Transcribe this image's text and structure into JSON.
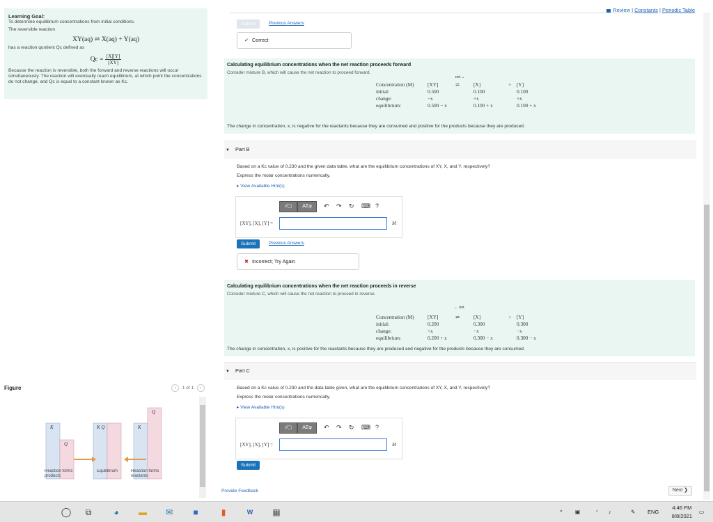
{
  "top_links": {
    "review": "Review",
    "constants": "Constants",
    "periodic": "Periodic Table",
    "sep": " | "
  },
  "goal": {
    "title": "Learning Goal:",
    "line1": "To determine equilibrium concentrations from initial conditions.",
    "line2": "The reversible reaction",
    "equation": "XY(aq) ⇌ X(aq) + Y(aq)",
    "line3": "has a reaction quotient Qc defined as",
    "qc_lhs": "Qc =",
    "qc_num": "[X][Y]",
    "qc_den": "[XY]",
    "line4": "Because the reaction is reversible, both the forward and reverse reactions will occur simultaneously. The reaction will eventually reach equilibrium, at which point the concentrations do not change, and Qc is equal to a constant known as Kc."
  },
  "figure": {
    "title": "Figure",
    "pager": "1 of 1",
    "labels": {
      "k1": "K",
      "q1": "Q",
      "kq": "K  Q",
      "q2": "Q",
      "k2": "K",
      "left": "Reaction forms products",
      "mid": "Equilibrium",
      "right": "Reaction forms reactants"
    }
  },
  "part_a_tail": {
    "submit": "Submit",
    "prev_answers": "Previous Answers",
    "feedback_mark": "✔",
    "feedback": "Correct"
  },
  "forward_box": {
    "title": "Calculating equilibrium concentrations when the net reaction proceeds forward",
    "subtitle": "Consider mixture B, which will cause the net reaction to proceed forward.",
    "net": "net→",
    "header": [
      "Concentration (M)",
      "[XY]",
      "⇌",
      "[X]",
      "+",
      "[Y]"
    ],
    "rows": [
      [
        "initial:",
        "0.500",
        "",
        "0.100",
        "",
        "0.100"
      ],
      [
        "change:",
        "−x",
        "",
        "+x",
        "",
        "+x"
      ],
      [
        "equilibrium:",
        "0.500 − x",
        "",
        "0.100 + x",
        "",
        "0.100 + x"
      ]
    ],
    "foot": "The change in concentration, x, is negative for the reactants because they are consumed and positive for the products because they are produced."
  },
  "part_b": {
    "label": "Part B",
    "question": "Based on a Kc value of 0.230 and the given data table, what are the equilibrium concentrations of XY, X, and Y, respectively?",
    "instruction": "Express the molar concentrations numerically.",
    "hint": "▸ View Available Hint(s)",
    "answer_label": "[XY], [X], [Y] =",
    "unit": "M",
    "submit": "Submit",
    "prev_answers": "Previous Answers",
    "feedback_mark": "✖",
    "feedback": "Incorrect; Try Again"
  },
  "reverse_box": {
    "title": "Calculating equilibrium concentrations when the net reaction proceeds in reverse",
    "subtitle": "Consider mixture C, which will cause the net reaction to proceed in reverse.",
    "net": "← net",
    "header": [
      "Concentration (M)",
      "[XY]",
      "⇌",
      "[X]",
      "+",
      "[Y]"
    ],
    "rows": [
      [
        "initial:",
        "0.200",
        "",
        "0.300",
        "",
        "0.300"
      ],
      [
        "change:",
        "+x",
        "",
        "−x",
        "",
        "−x"
      ],
      [
        "equilibrium:",
        "0.200 + x",
        "",
        "0.300 − x",
        "",
        "0.300 − x"
      ]
    ],
    "foot": "The change in concentration, x, is positive for the reactants because they are produced and negative for the products because they are consumed."
  },
  "part_c": {
    "label": "Part C",
    "question": "Based on a Kc value of 0.230 and the data table given, what are the equilibrium concentrations of XY, X, and Y, respectively?",
    "instruction": "Express the molar concentrations numerically.",
    "hint": "▸ View Available Hint(s)",
    "answer_label": "[XY], [X], [Y] =",
    "unit": "M",
    "submit": "Submit"
  },
  "toolbar": {
    "templates": "√▢",
    "symbols": "AΣφ",
    "help": "?"
  },
  "footer": {
    "provide_feedback": "Provide Feedback",
    "next": "Next ❯"
  },
  "taskbar": {
    "lang": "ENG",
    "time": "4:46 PM",
    "date": "8/8/2021"
  },
  "colors": {
    "accent": "#1a73b8",
    "teal_panel": "#e9f6f2",
    "correct": "#2e8b3a",
    "incorrect": "#c62020"
  }
}
